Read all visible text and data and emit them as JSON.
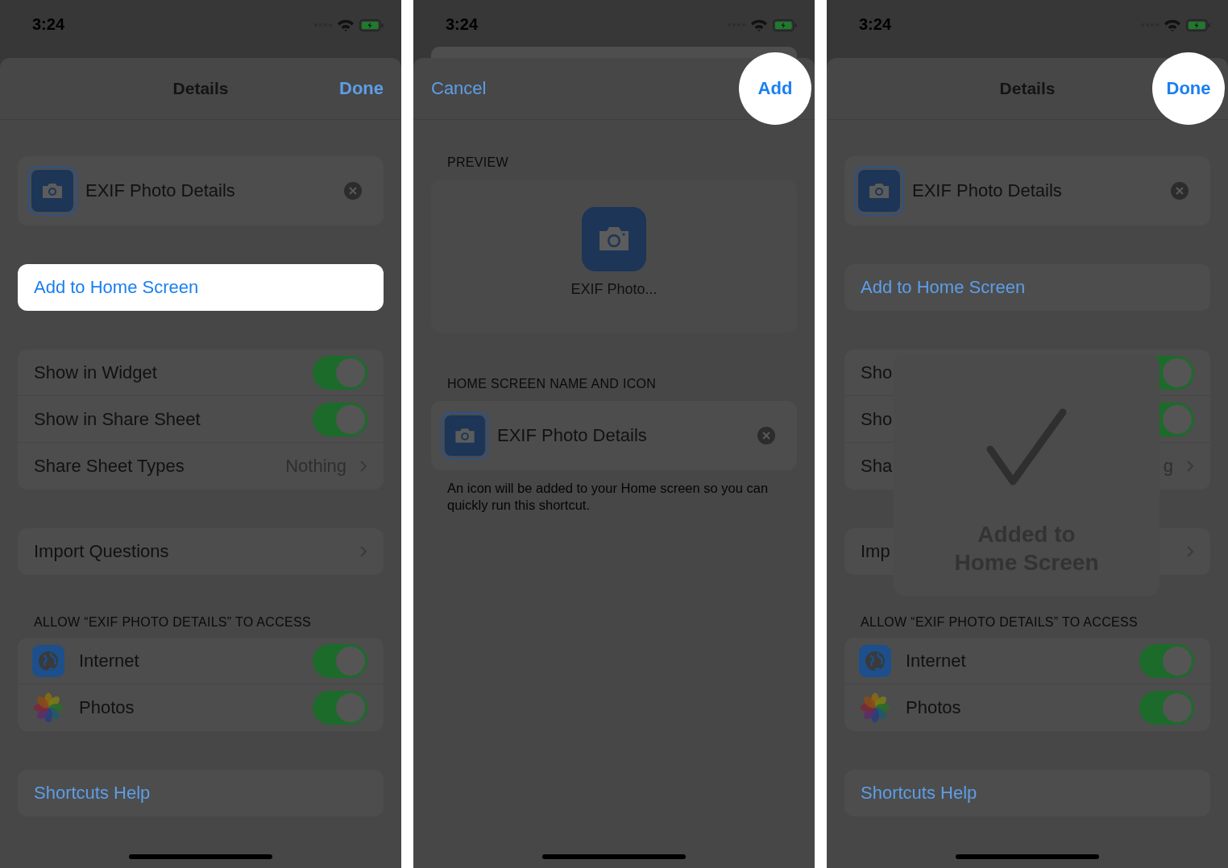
{
  "panels": [
    {
      "kind": "details",
      "status": {
        "time": "3:24"
      },
      "nav": {
        "title": "Details",
        "action": {
          "label": "Done",
          "highlighted": false
        }
      },
      "shortcut": {
        "name": "EXIF Photo Details"
      },
      "add_row": {
        "label": "Add to Home Screen",
        "highlighted": true
      },
      "settings": [
        {
          "kind": "toggle",
          "label": "Show in Widget",
          "on": true
        },
        {
          "kind": "toggle",
          "label": "Show in Share Sheet",
          "on": true
        },
        {
          "kind": "link",
          "label": "Share Sheet Types",
          "value": "Nothing"
        }
      ],
      "import_row": {
        "label": "Import Questions"
      },
      "access": {
        "header": "ALLOW “EXIF PHOTO DETAILS” TO ACCESS",
        "items": [
          {
            "kind": "internet",
            "label": "Internet",
            "on": true
          },
          {
            "kind": "photos",
            "label": "Photos",
            "on": true
          }
        ]
      },
      "help": {
        "label": "Shortcuts Help"
      }
    },
    {
      "kind": "add",
      "status": {
        "time": "3:24"
      },
      "nav": {
        "cancel": "Cancel",
        "action": {
          "label": "Add",
          "highlighted": true
        }
      },
      "preview": {
        "header": "PREVIEW",
        "label": "EXIF Photo..."
      },
      "name_section": {
        "header": "HOME SCREEN NAME AND ICON",
        "name": "EXIF Photo Details",
        "footnote": "An icon will be added to your Home screen so you can quickly run this shortcut."
      }
    },
    {
      "kind": "details",
      "status": {
        "time": "3:24"
      },
      "nav": {
        "title": "Details",
        "action": {
          "label": "Done",
          "highlighted": true
        }
      },
      "shortcut": {
        "name": "EXIF Photo Details"
      },
      "add_row": {
        "label": "Add to Home Screen",
        "highlighted": false
      },
      "settings": [
        {
          "kind": "toggle",
          "label": "Sho",
          "on": true
        },
        {
          "kind": "toggle",
          "label": "Sho",
          "on": true
        },
        {
          "kind": "link",
          "label": "Sha",
          "value": "g"
        }
      ],
      "import_row": {
        "label": "Imp"
      },
      "access": {
        "header": "ALLOW “EXIF PHOTO DETAILS” TO ACCESS",
        "items": [
          {
            "kind": "internet",
            "label": "Internet",
            "on": true
          },
          {
            "kind": "photos",
            "label": "Photos",
            "on": true
          }
        ]
      },
      "help": {
        "label": "Shortcuts Help"
      },
      "hud": {
        "message": "Added to Home Screen"
      }
    }
  ]
}
